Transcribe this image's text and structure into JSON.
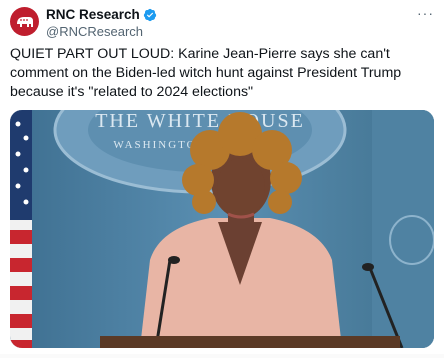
{
  "author": {
    "name": "RNC Research",
    "handle": "@RNCResearch",
    "verified": true,
    "avatar_icon": "elephant-icon",
    "avatar_color": "#bf1e2e"
  },
  "menu": {
    "label": "···"
  },
  "tweet": {
    "text": "QUIET PART OUT LOUD: Karine Jean-Pierre says she can't comment on the Biden-led witch hunt against President Trump because it's \"related to 2024 elections\""
  },
  "media": {
    "background_text_top": "THE WHITE HOUSE",
    "background_text_bottom": "WASHINGTON"
  },
  "colors": {
    "verified": "#1d9bf0",
    "handle": "#536471"
  }
}
